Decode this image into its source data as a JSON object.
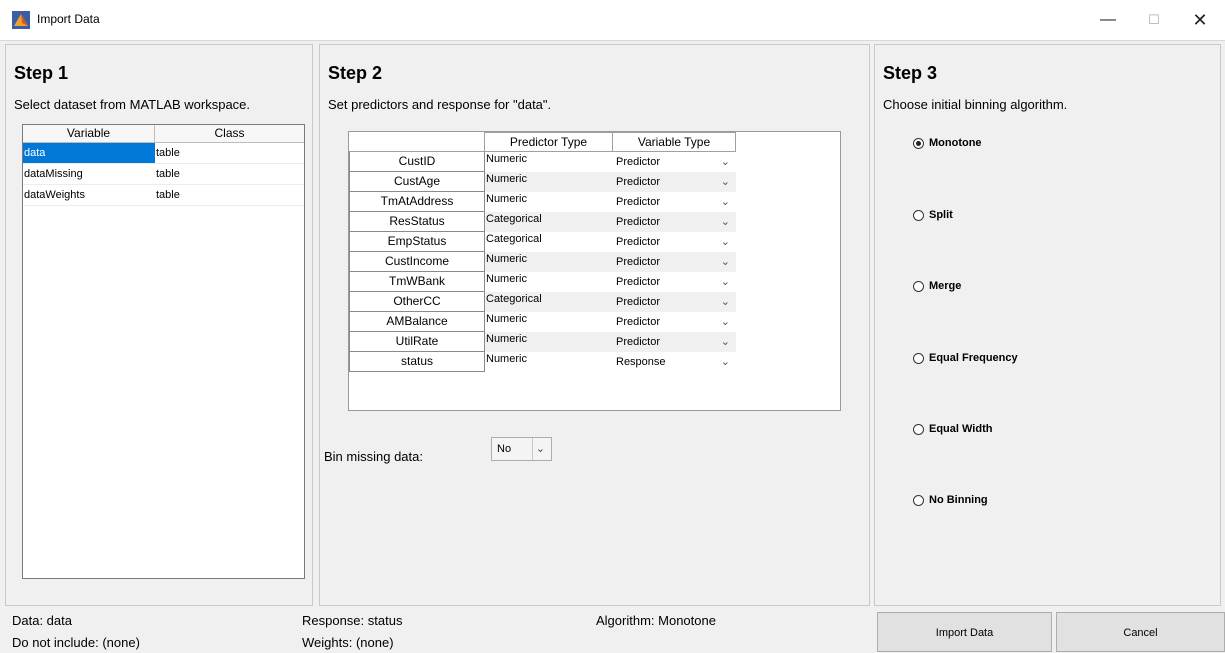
{
  "window": {
    "title": "Import Data",
    "minimize": "—",
    "maximize": "☐",
    "close": "✕"
  },
  "step1": {
    "title": "Step 1",
    "description": "Select dataset from MATLAB workspace.",
    "columns": [
      "Variable",
      "Class"
    ],
    "rows": [
      {
        "variable": "data",
        "class": "table"
      },
      {
        "variable": "dataMissing",
        "class": "table"
      },
      {
        "variable": "dataWeights",
        "class": "table"
      }
    ]
  },
  "step2": {
    "title": "Step 2",
    "description": "Set predictors and response for \"data\".",
    "columns": [
      "Predictor Type",
      "Variable Type"
    ],
    "rows": [
      {
        "name": "CustID",
        "predictor_type": "Numeric",
        "variable_type": "Predictor"
      },
      {
        "name": "CustAge",
        "predictor_type": "Numeric",
        "variable_type": "Predictor"
      },
      {
        "name": "TmAtAddress",
        "predictor_type": "Numeric",
        "variable_type": "Predictor"
      },
      {
        "name": "ResStatus",
        "predictor_type": "Categorical",
        "variable_type": "Predictor"
      },
      {
        "name": "EmpStatus",
        "predictor_type": "Categorical",
        "variable_type": "Predictor"
      },
      {
        "name": "CustIncome",
        "predictor_type": "Numeric",
        "variable_type": "Predictor"
      },
      {
        "name": "TmWBank",
        "predictor_type": "Numeric",
        "variable_type": "Predictor"
      },
      {
        "name": "OtherCC",
        "predictor_type": "Categorical",
        "variable_type": "Predictor"
      },
      {
        "name": "AMBalance",
        "predictor_type": "Numeric",
        "variable_type": "Predictor"
      },
      {
        "name": "UtilRate",
        "predictor_type": "Numeric",
        "variable_type": "Predictor"
      },
      {
        "name": "status",
        "predictor_type": "Numeric",
        "variable_type": "Response"
      }
    ],
    "bin_missing_label": "Bin missing data:",
    "bin_missing_value": "No"
  },
  "step3": {
    "title": "Step 3",
    "description": "Choose initial binning algorithm.",
    "options": [
      {
        "label": "Monotone",
        "selected": true
      },
      {
        "label": "Split",
        "selected": false
      },
      {
        "label": "Merge",
        "selected": false
      },
      {
        "label": "Equal Frequency",
        "selected": false
      },
      {
        "label": "Equal Width",
        "selected": false
      },
      {
        "label": "No Binning",
        "selected": false
      }
    ]
  },
  "status": {
    "data": "Data: data",
    "do_not_include": "Do not include: (none)",
    "response": "Response: status",
    "weights": "Weights: (none)",
    "algorithm": "Algorithm: Monotone"
  },
  "buttons": {
    "import": "Import Data",
    "cancel": "Cancel"
  },
  "colors": {
    "selection": "#0078d7",
    "background": "#f0f0f0"
  }
}
